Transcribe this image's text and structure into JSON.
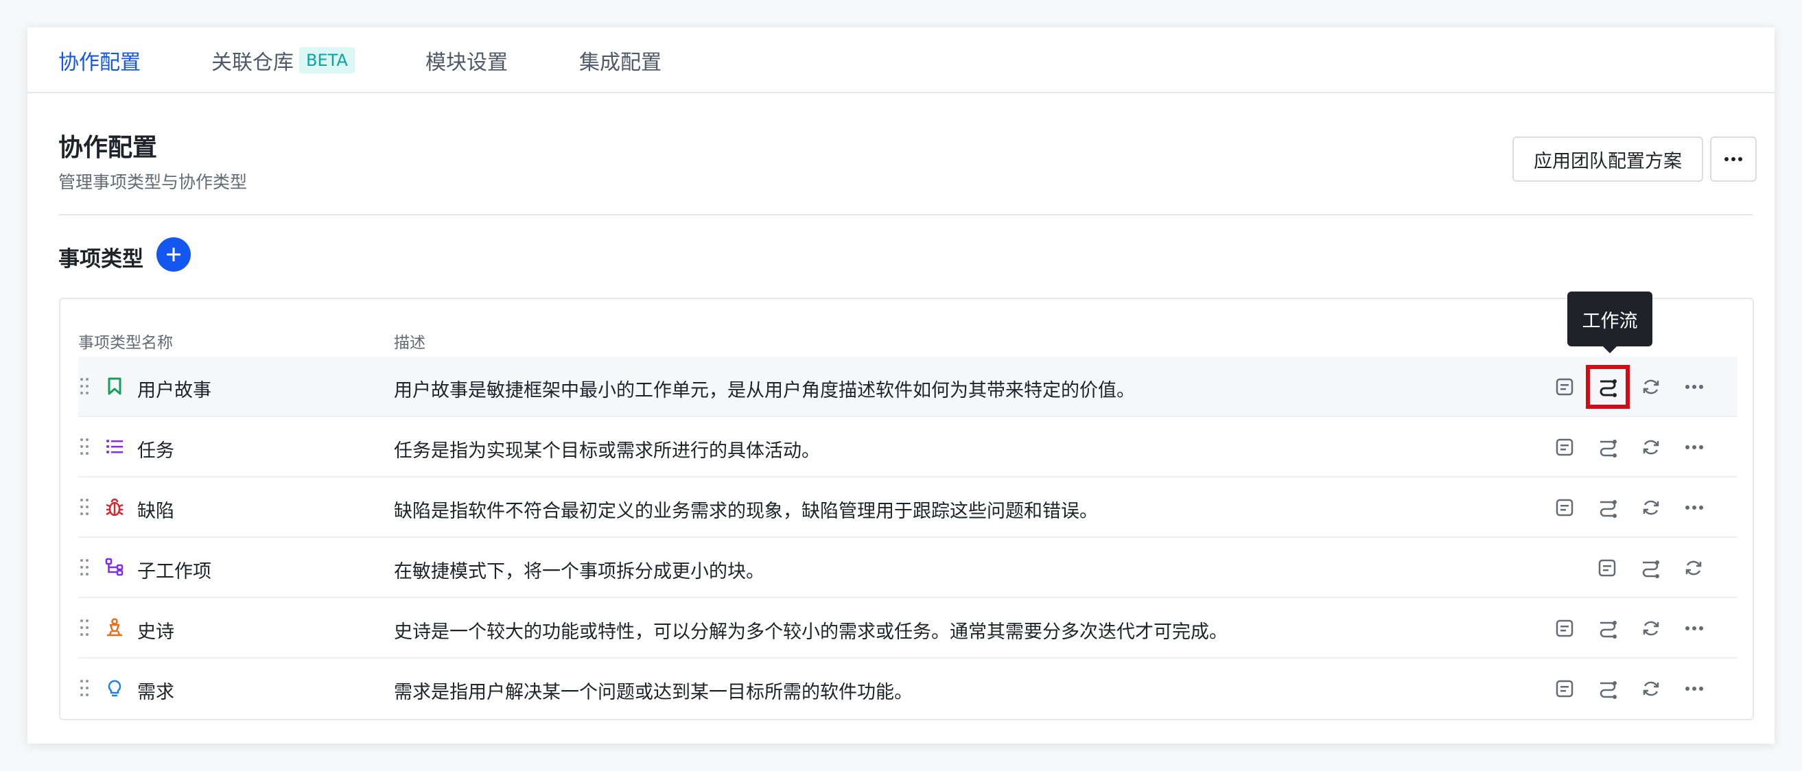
{
  "tabs": [
    {
      "label": "协作配置",
      "active": true
    },
    {
      "label": "关联仓库",
      "badge": "BETA"
    },
    {
      "label": "模块设置"
    },
    {
      "label": "集成配置"
    }
  ],
  "header": {
    "title": "协作配置",
    "subtitle": "管理事项类型与协作类型",
    "apply_button": "应用团队配置方案",
    "more_icon": "ellipsis-icon"
  },
  "section": {
    "title": "事项类型",
    "add_icon": "plus-icon"
  },
  "table": {
    "columns": [
      "事项类型名称",
      "描述"
    ],
    "rows": [
      {
        "name": "用户故事",
        "icon": "bookmark-icon",
        "color": "#12a05c",
        "description": "用户故事是敏捷框架中最小的工作单元，是从用户角度描述软件如何为其带来特定的价值。"
      },
      {
        "name": "任务",
        "icon": "list-icon",
        "color": "#8a2be2",
        "description": "任务是指为实现某个目标或需求所进行的具体活动。"
      },
      {
        "name": "缺陷",
        "icon": "bug-icon",
        "color": "#d9262e",
        "description": "缺陷是指软件不符合最初定义的业务需求的现象，缺陷管理用于跟踪这些问题和错误。"
      },
      {
        "name": "子工作项",
        "icon": "subtask-icon",
        "color": "#7b2bf9",
        "description": "在敏捷模式下，将一个事项拆分成更小的块。"
      },
      {
        "name": "史诗",
        "icon": "epic-icon",
        "color": "#f06a16",
        "description": "史诗是一个较大的功能或特性，可以分解为多个较小的需求或任务。通常其需要分多次迭代才可完成。"
      },
      {
        "name": "需求",
        "icon": "lightbulb-icon",
        "color": "#1e7ef5",
        "description": "需求是指用户解决某一个问题或达到某一目标所需的软件功能。"
      }
    ]
  },
  "tooltip": "工作流",
  "colors": {
    "accent": "#1456f0",
    "highlight": "#d40a14"
  }
}
